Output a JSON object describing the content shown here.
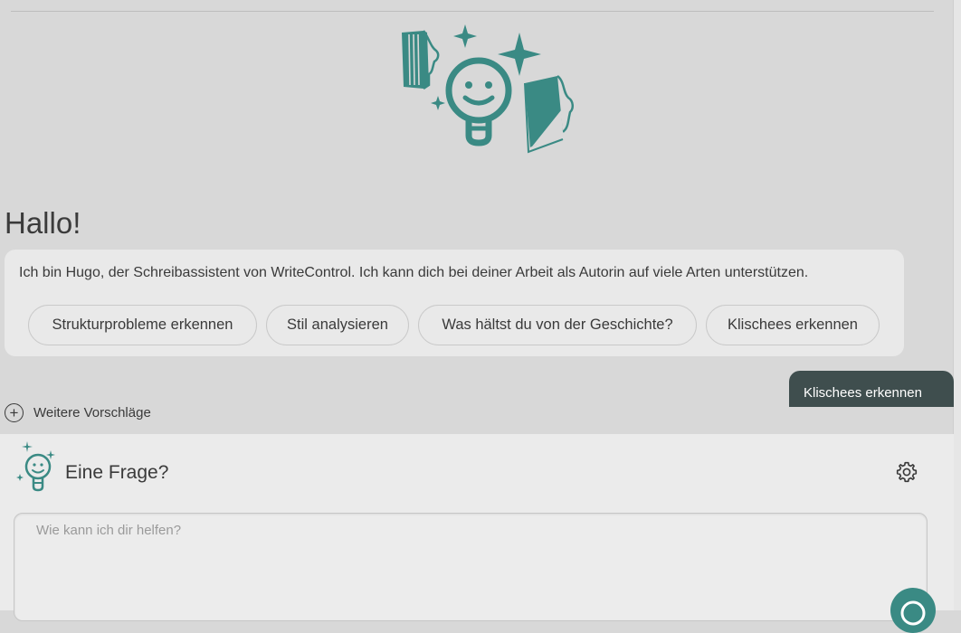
{
  "colors": {
    "accent": "#3a8a84",
    "background": "#d8d8d8",
    "card": "#e9e9e9",
    "user_bubble": "#3f4e4e"
  },
  "hero": {
    "icon": "lightbulb-books-illustration"
  },
  "chat": {
    "greeting": "Hallo!",
    "intro": "Ich bin Hugo, der Schreibassistent von WriteControl. Ich kann dich bei deiner Arbeit als Autorin auf viele Arten unterstützen.",
    "suggestions": [
      "Strukturprobleme erkennen",
      "Stil analysieren",
      "Was hältst du von der Geschichte?",
      "Klischees erkennen"
    ],
    "user_message": "Klischees erkennen"
  },
  "more_suggestions": {
    "label": "Weitere Vorschläge",
    "icon": "plus-circle-icon"
  },
  "assistant_panel": {
    "icon": "lightbulb-icon",
    "title": "Eine Frage?",
    "settings_icon": "gear-icon",
    "input_placeholder": "Wie kann ich dir helfen?",
    "send_icon": "send-icon"
  }
}
